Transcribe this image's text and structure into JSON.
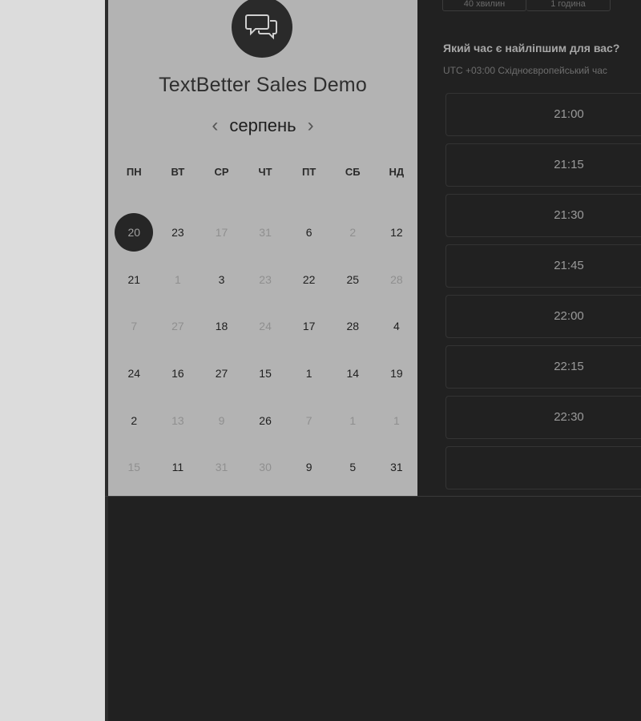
{
  "calendar": {
    "title": "TextBetter Sales Demo",
    "month": "серпень",
    "prev_icon": "‹",
    "next_icon": "›",
    "weekdays": [
      "ПН",
      "ВТ",
      "СР",
      "ЧТ",
      "ПТ",
      "СБ",
      "НД"
    ],
    "selected_day": "20",
    "rows": [
      [
        {
          "d": "20",
          "s": "selected"
        },
        {
          "d": "23",
          "s": "available"
        },
        {
          "d": "17",
          "s": "muted"
        },
        {
          "d": "31",
          "s": "muted"
        },
        {
          "d": "6",
          "s": "available"
        },
        {
          "d": "2",
          "s": "muted"
        },
        {
          "d": "12",
          "s": "available"
        }
      ],
      [
        {
          "d": "21",
          "s": "available"
        },
        {
          "d": "1",
          "s": "muted"
        },
        {
          "d": "3",
          "s": "available"
        },
        {
          "d": "23",
          "s": "muted"
        },
        {
          "d": "22",
          "s": "available"
        },
        {
          "d": "25",
          "s": "available"
        },
        {
          "d": "28",
          "s": "muted"
        }
      ],
      [
        {
          "d": "7",
          "s": "muted"
        },
        {
          "d": "27",
          "s": "muted"
        },
        {
          "d": "18",
          "s": "available"
        },
        {
          "d": "24",
          "s": "muted"
        },
        {
          "d": "17",
          "s": "available"
        },
        {
          "d": "28",
          "s": "available"
        },
        {
          "d": "4",
          "s": "available"
        }
      ],
      [
        {
          "d": "24",
          "s": "available"
        },
        {
          "d": "16",
          "s": "available"
        },
        {
          "d": "27",
          "s": "available"
        },
        {
          "d": "15",
          "s": "available"
        },
        {
          "d": "1",
          "s": "available"
        },
        {
          "d": "14",
          "s": "available"
        },
        {
          "d": "19",
          "s": "available"
        }
      ],
      [
        {
          "d": "2",
          "s": "available"
        },
        {
          "d": "13",
          "s": "muted"
        },
        {
          "d": "9",
          "s": "muted"
        },
        {
          "d": "26",
          "s": "available"
        },
        {
          "d": "7",
          "s": "muted"
        },
        {
          "d": "1",
          "s": "muted"
        },
        {
          "d": "1",
          "s": "muted"
        }
      ],
      [
        {
          "d": "15",
          "s": "muted"
        },
        {
          "d": "11",
          "s": "available"
        },
        {
          "d": "31",
          "s": "muted"
        },
        {
          "d": "30",
          "s": "muted"
        },
        {
          "d": "9",
          "s": "available"
        },
        {
          "d": "5",
          "s": "available"
        },
        {
          "d": "31",
          "s": "available"
        }
      ]
    ]
  },
  "duration_tabs": [
    "40 хвилин",
    "1 година"
  ],
  "time_picker": {
    "question": "Який час є найліпшим для вас?",
    "timezone": "UTC +03:00 Східноєвропейський час",
    "slots": [
      "21:00",
      "21:15",
      "21:30",
      "21:45",
      "22:00",
      "22:15",
      "22:30",
      ""
    ]
  },
  "colors": {
    "page_bg": "#212121",
    "gutter": "#dcdcdc",
    "calendar_panel": "#b3b3b3",
    "selected_day_bg": "#262626"
  },
  "icons": {
    "logo": "chat-bubbles-icon"
  }
}
